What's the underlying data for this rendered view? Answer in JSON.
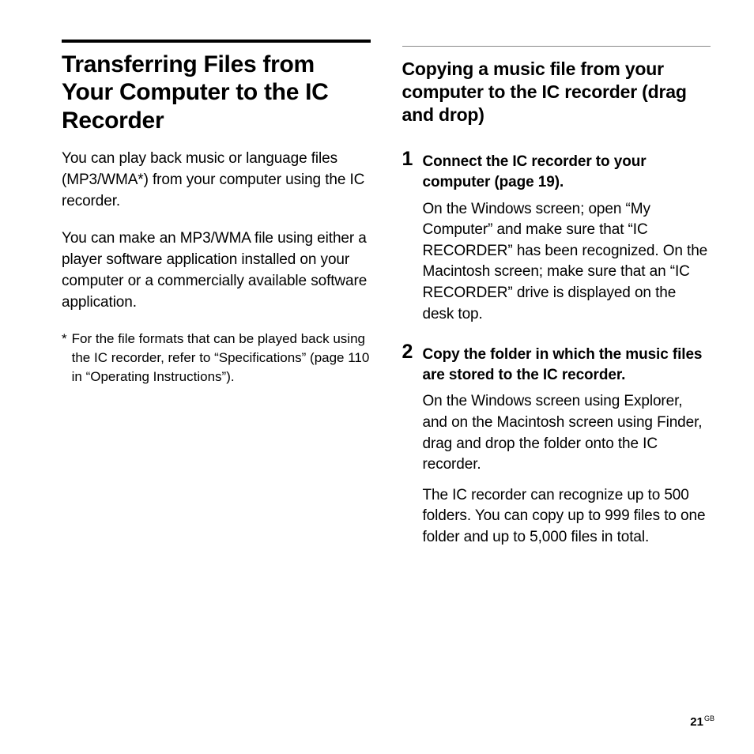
{
  "left": {
    "title": "Transferring Files from Your Computer to the IC Recorder",
    "para1": "You can play back music or language files (MP3/WMA*) from your computer using the IC recorder.",
    "para2": "You can make an MP3/WMA file using either a player software application installed on your computer or a commercially available software application.",
    "footnote_star": "*",
    "footnote": "For the file formats that can be played back using the IC recorder, refer to “Specifications” (page 110 in “Operating Instructions”)."
  },
  "right": {
    "subtitle": "Copying a music file from your computer to the IC recorder (drag and drop)",
    "steps": [
      {
        "num": "1",
        "title": "Connect the IC recorder to your computer (page 19).",
        "body1": "On the Windows screen; open “My Computer” and make sure that “IC RECORDER” has been recognized. On the Macintosh screen; make sure that an “IC RECORDER” drive is displayed on the desk top."
      },
      {
        "num": "2",
        "title": "Copy the folder in which the music files are stored to the IC recorder.",
        "body1": "On the Windows screen using Explorer, and on the Macintosh screen using Finder, drag and drop the folder onto the IC recorder.",
        "body2": "The IC recorder can recognize up to 500 folders. You can copy up to 999 files to one folder and up to 5,000 files in total."
      }
    ]
  },
  "page": {
    "number": "21",
    "lang": "GB"
  }
}
